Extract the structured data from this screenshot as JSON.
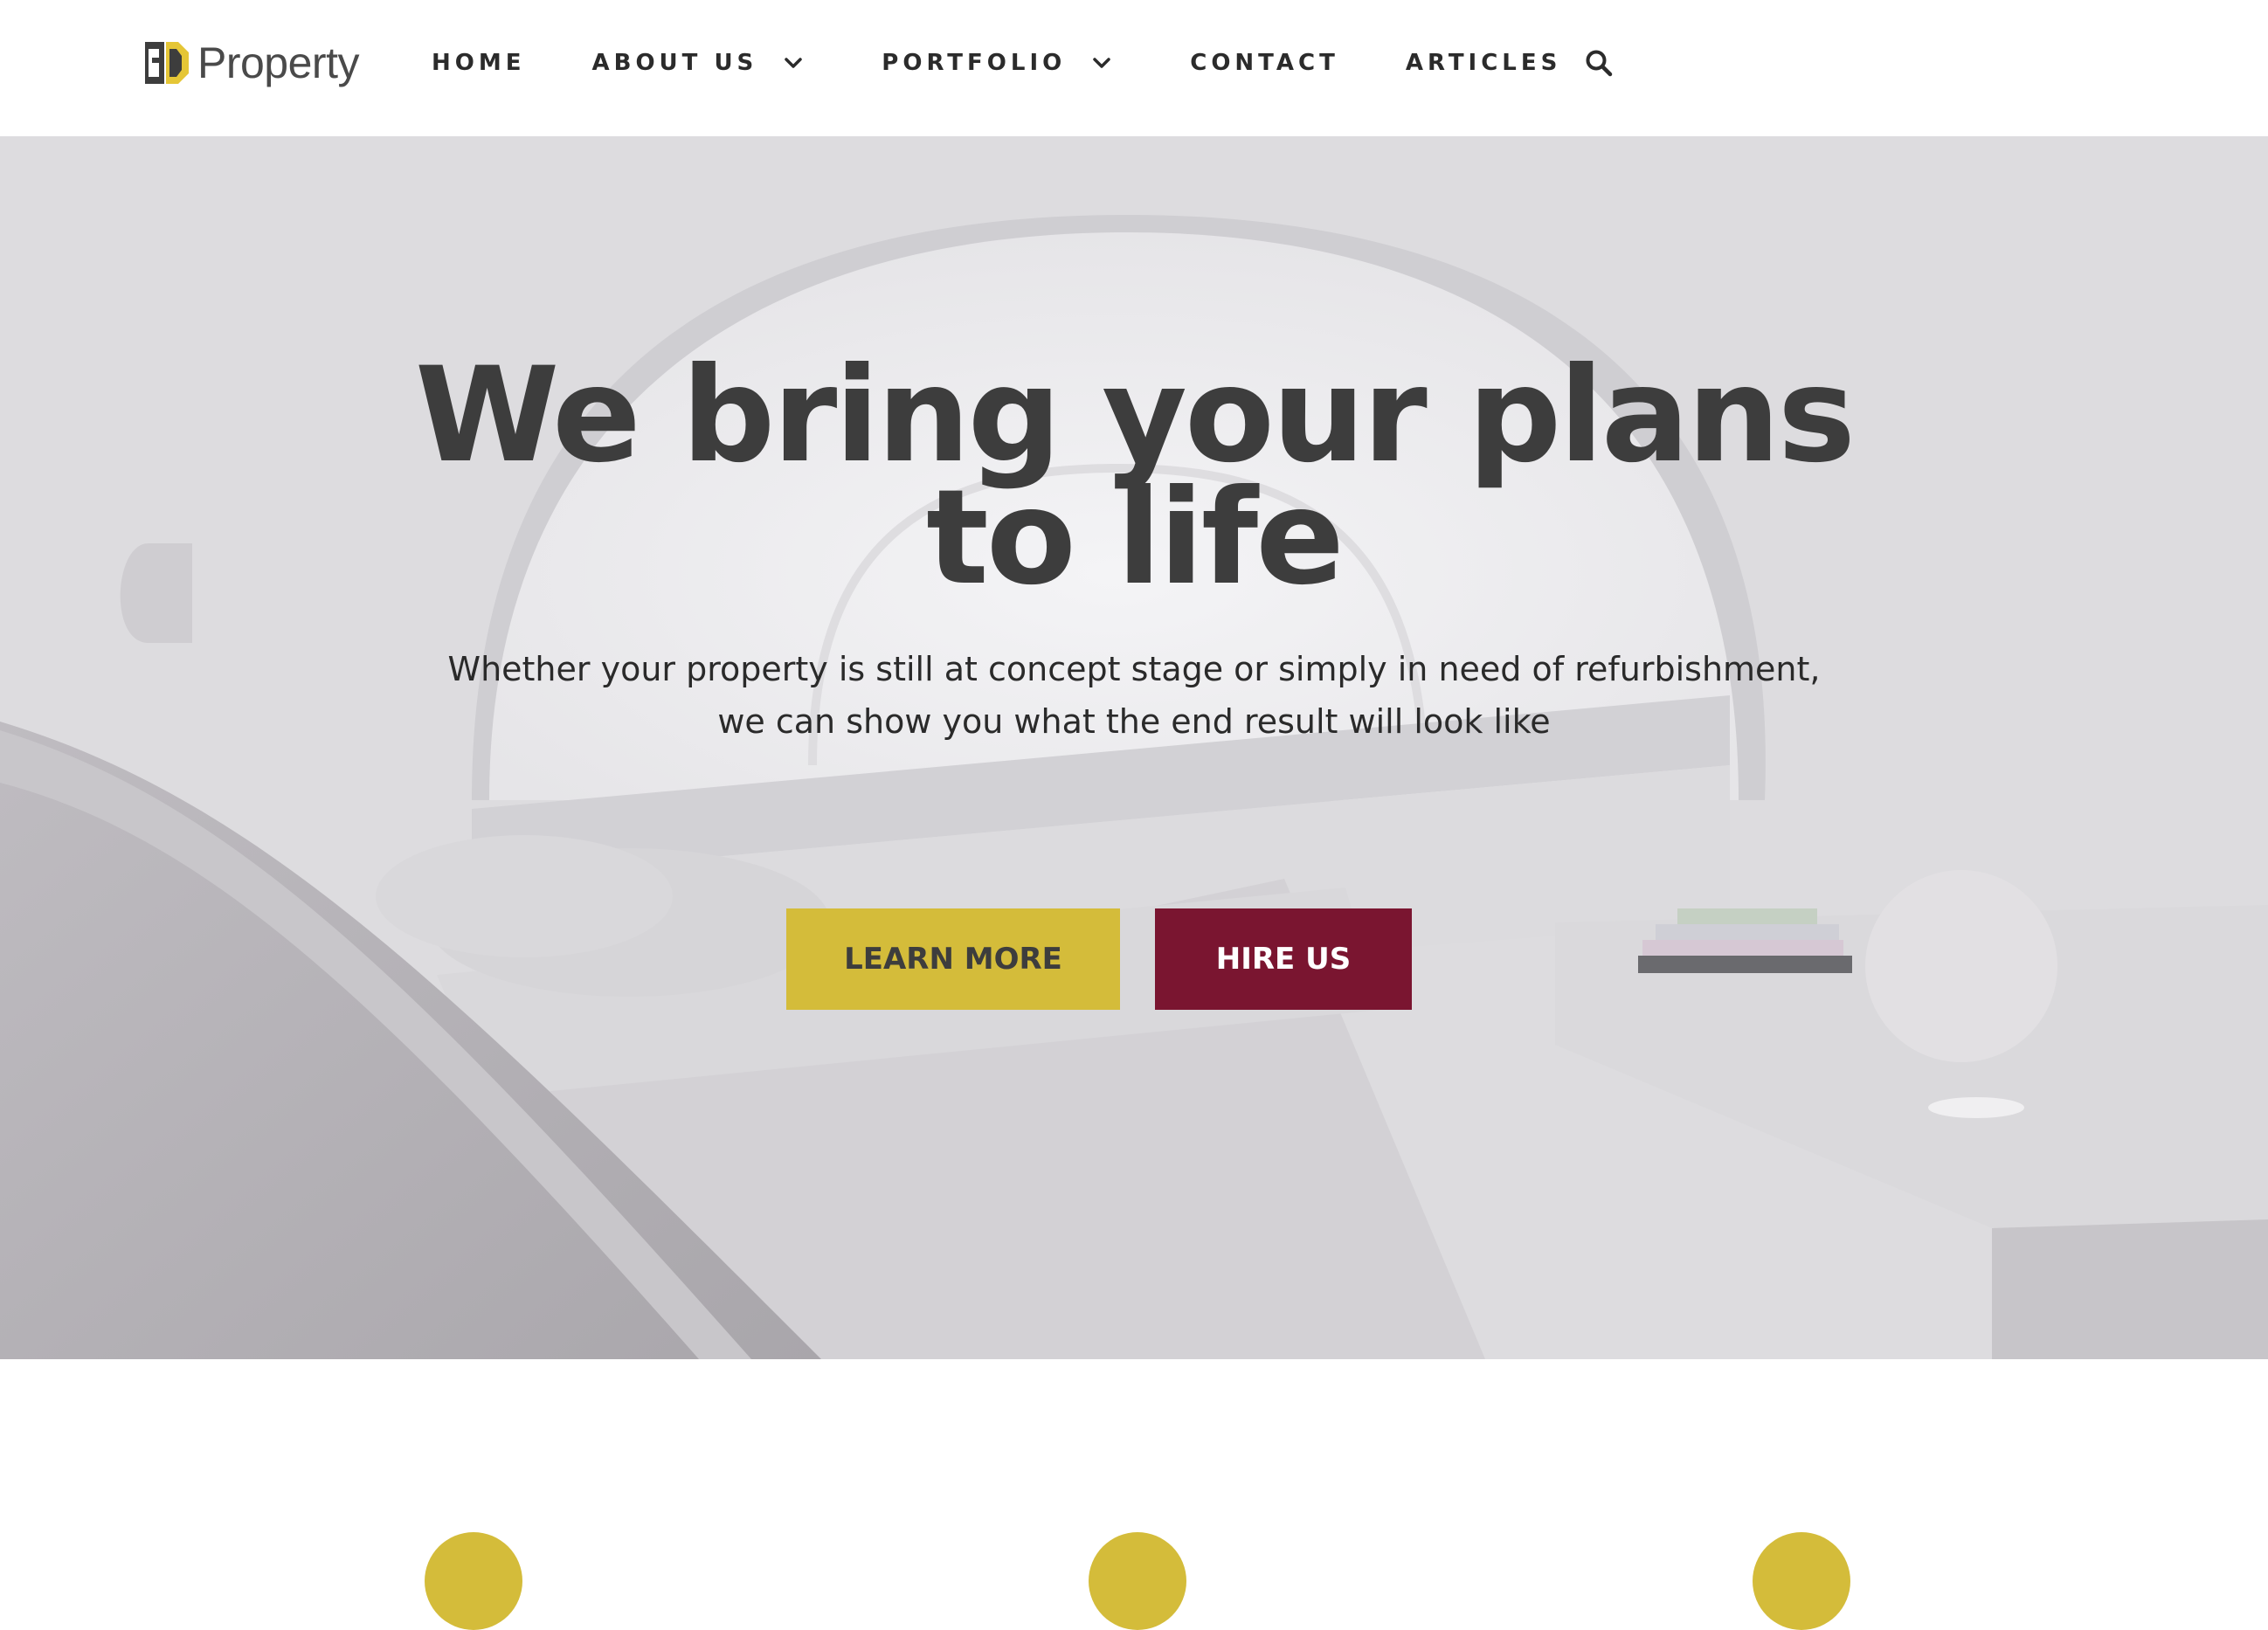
{
  "brand": {
    "name": "Property",
    "logo_icon": "3d-logo-icon",
    "colors": {
      "accent_yellow": "#d4bc3a",
      "accent_maroon": "#7a1530",
      "text_dark": "#3d3d3d"
    }
  },
  "nav": {
    "items": [
      {
        "label": "HOME"
      },
      {
        "label": "ABOUT US",
        "icon": "chevron-down-icon"
      },
      {
        "label": "PORTFOLIO",
        "icon": "chevron-down-icon"
      },
      {
        "label": "CONTACT"
      },
      {
        "label": "ARTICLES"
      }
    ],
    "search_icon": "search-icon"
  },
  "hero": {
    "title_line1": "We bring your plans",
    "title_line2": "to life",
    "subtitle_line1": "Whether your property is still at concept stage or simply in need of refurbishment,",
    "subtitle_line2": "we can show you what the end result will look like",
    "primary_button": "LEARN MORE",
    "secondary_button": "HIRE US"
  }
}
